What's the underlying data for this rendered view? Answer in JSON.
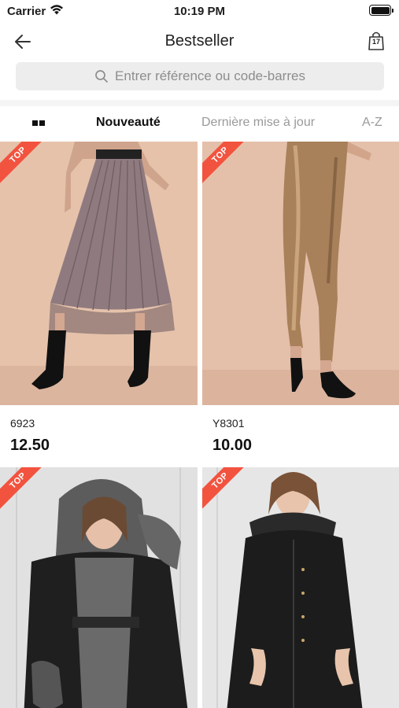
{
  "status_bar": {
    "carrier": "Carrier",
    "time": "10:19 PM"
  },
  "nav": {
    "title": "Bestseller",
    "bag_count": "17"
  },
  "search": {
    "placeholder": "Entrer référence ou code-barres"
  },
  "sort_tabs": [
    {
      "label": "Nouveauté",
      "active": true
    },
    {
      "label": "Dernière mise à jour",
      "active": false
    },
    {
      "label": "A-Z",
      "active": false
    }
  ],
  "products": [
    {
      "ref": "6923",
      "price": "12.50",
      "badge": "TOP",
      "image": "pleated-tulle-skirt-photo"
    },
    {
      "ref": "Y8301",
      "price": "10.00",
      "badge": "TOP",
      "image": "metallic-leggings-photo"
    },
    {
      "ref": "",
      "price": "",
      "badge": "TOP",
      "image": "faux-fur-hooded-jacket-photo"
    },
    {
      "ref": "",
      "price": "",
      "badge": "TOP",
      "image": "black-parka-photo"
    }
  ],
  "colors": {
    "badge": "#f2533f",
    "beige_backdrop": "#e6c2ab",
    "grey_backdrop": "#dcdcdc"
  }
}
